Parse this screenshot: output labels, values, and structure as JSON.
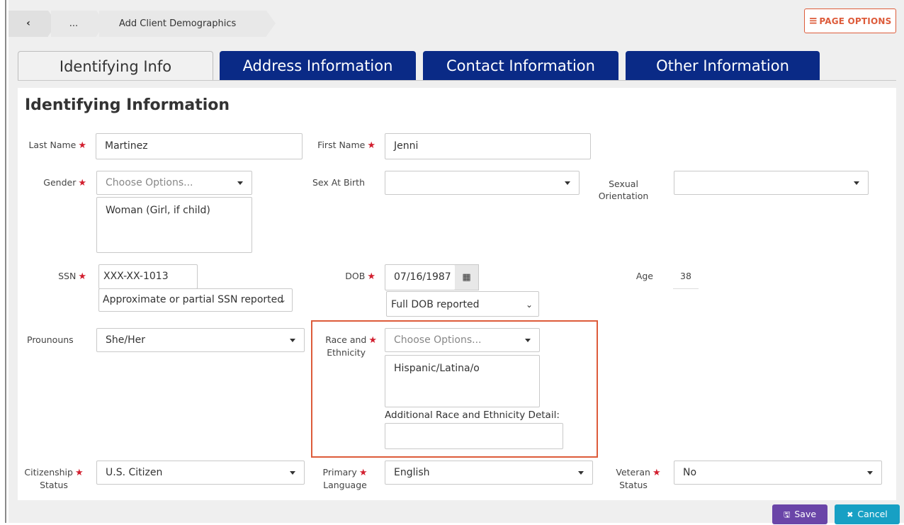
{
  "breadcrumb": {
    "back": "‹",
    "more": "...",
    "current": "Add Client Demographics"
  },
  "page_options": {
    "icon": "≡",
    "label": "PAGE OPTIONS"
  },
  "tabs": [
    {
      "label": "Identifying Info",
      "active": true
    },
    {
      "label": "Address Information",
      "active": false
    },
    {
      "label": "Contact Information",
      "active": false
    },
    {
      "label": "Other Information",
      "active": false
    }
  ],
  "section_title": "Identifying Information",
  "fields": {
    "last_name": {
      "label": "Last Name",
      "value": "Martinez"
    },
    "first_name": {
      "label": "First Name",
      "value": "Jenni"
    },
    "gender": {
      "label": "Gender",
      "placeholder": "Choose Options...",
      "selected": "Woman (Girl, if child)"
    },
    "sex_at_birth": {
      "label": "Sex At Birth",
      "value": ""
    },
    "sexual_orientation": {
      "label_line1": "Sexual",
      "label_line2": "Orientation",
      "value": ""
    },
    "ssn": {
      "label": "SSN",
      "value": "XXX-XX-1013",
      "quality": "Approximate or partial SSN reported"
    },
    "dob": {
      "label": "DOB",
      "value": "07/16/1987",
      "quality": "Full DOB reported"
    },
    "age": {
      "label": "Age",
      "value": "38"
    },
    "pronouns": {
      "label": "Prounouns",
      "value": "She/Her"
    },
    "race": {
      "label_line1": "Race and",
      "label_line2": "Ethnicity",
      "placeholder": "Choose Options...",
      "selected": "Hispanic/Latina/o",
      "detail_label": "Additional Race and Ethnicity Detail:",
      "detail_value": ""
    },
    "citizenship": {
      "label_line1": "Citizenship",
      "label_line2": "Status",
      "value": "U.S. Citizen"
    },
    "language": {
      "label_line1": "Primary",
      "label_line2": "Language",
      "value": "English"
    },
    "veteran": {
      "label_line1": "Veteran",
      "label_line2": "Status",
      "value": "No"
    }
  },
  "required_mark": "★",
  "buttons": {
    "save": {
      "icon": "🖫",
      "label": "Save"
    },
    "cancel": {
      "icon": "✖",
      "label": "Cancel"
    }
  },
  "colors": {
    "tab_active_bg": "#f1f1f1",
    "tab_inactive_bg": "#0a2a86",
    "accent_orange": "#dd5b3a",
    "required_red": "#d21f2f",
    "save_purple": "#6a45a8",
    "cancel_teal": "#17a0c4"
  }
}
